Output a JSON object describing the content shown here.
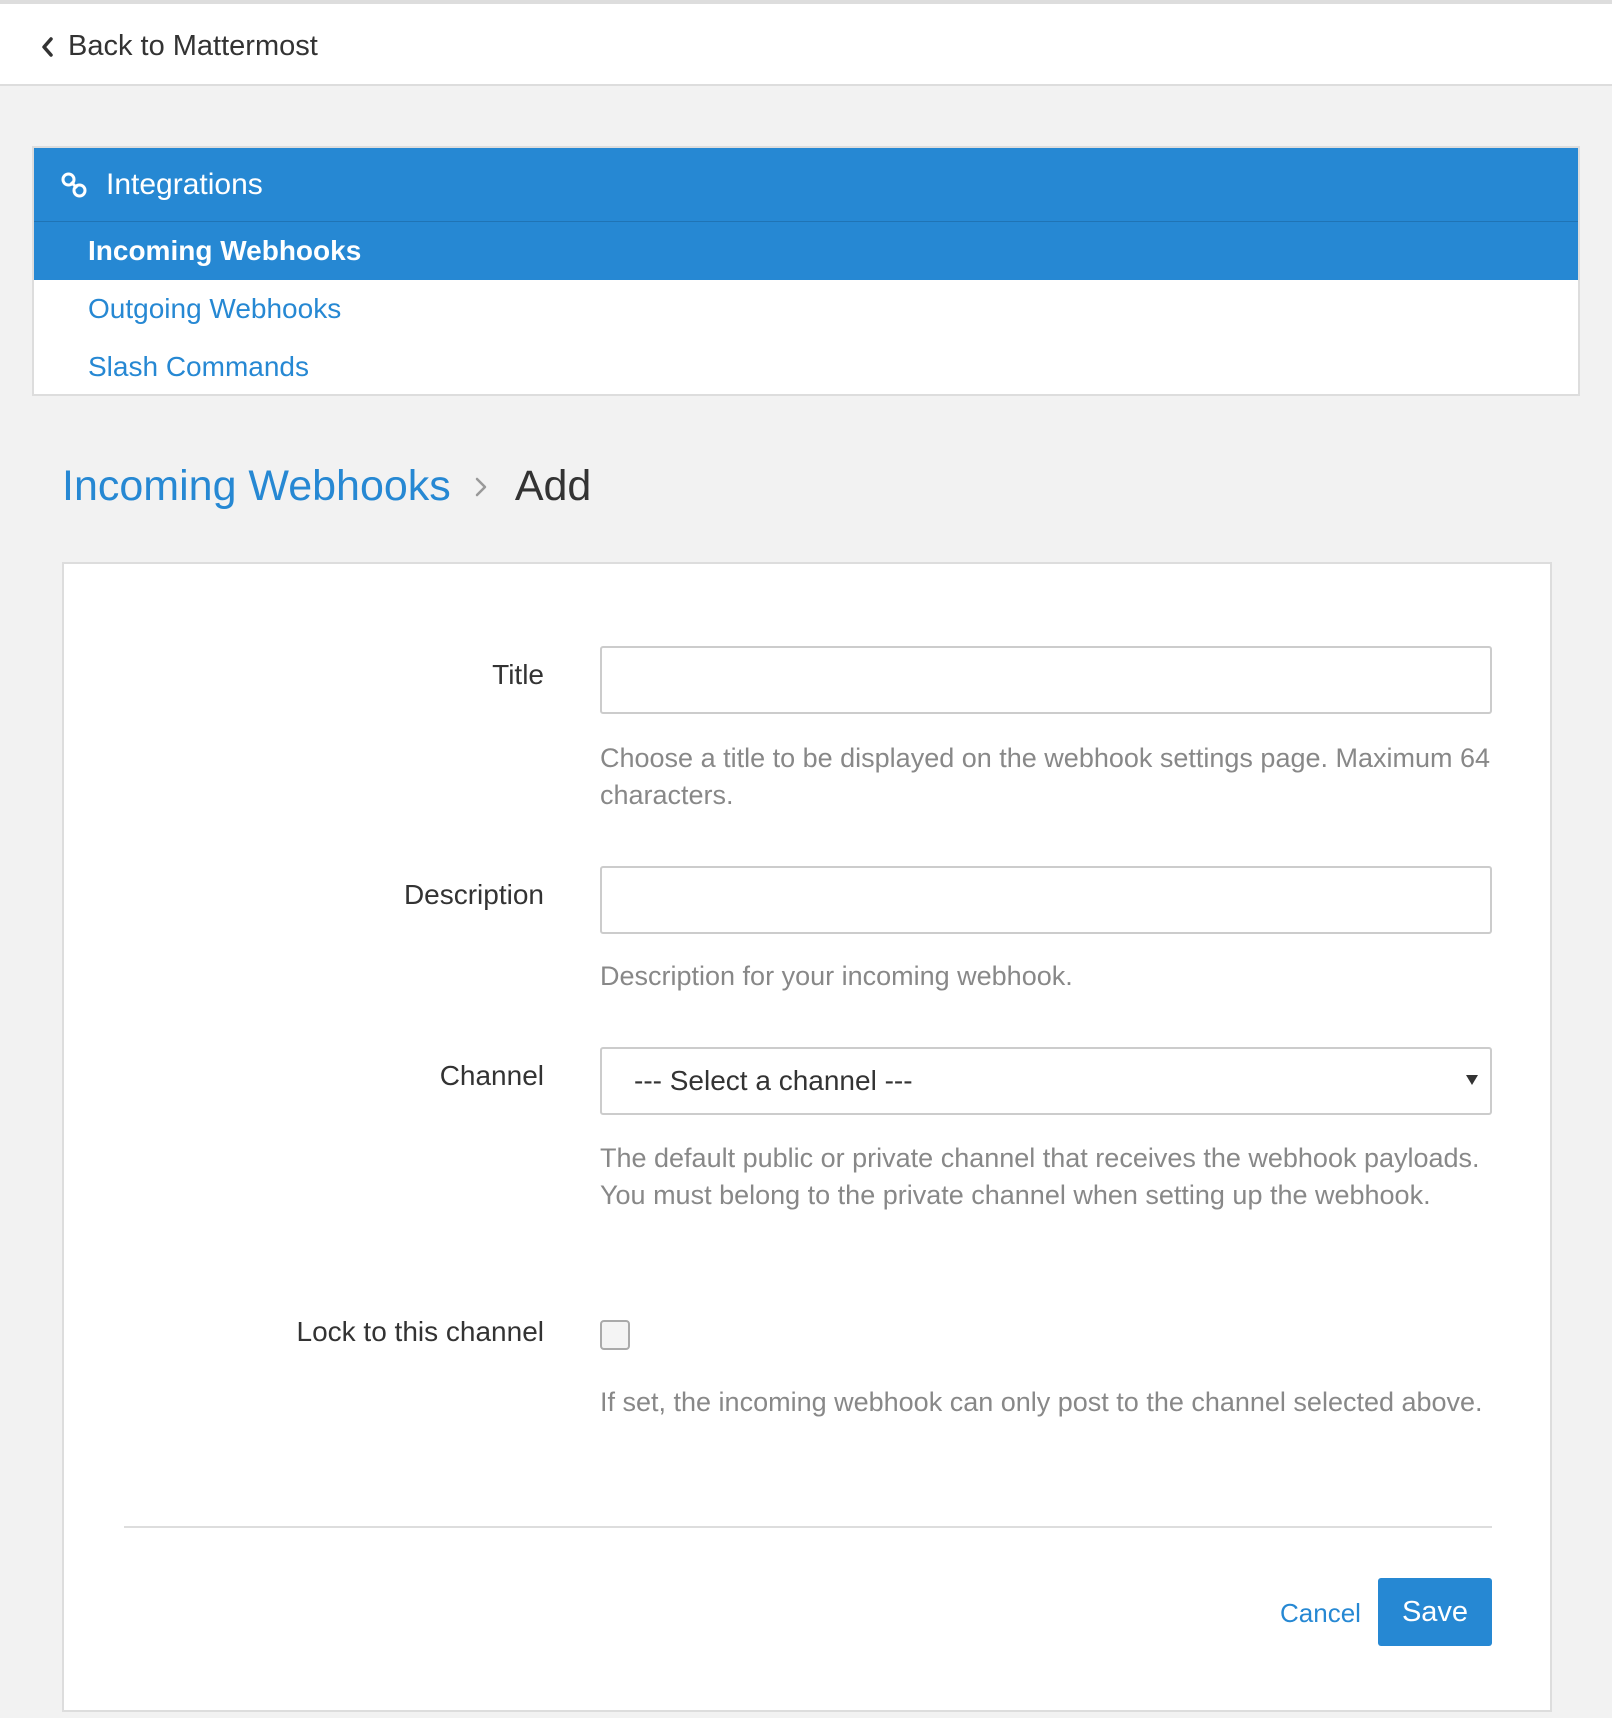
{
  "back_link": {
    "label": "Back to Mattermost"
  },
  "menu": {
    "header": "Integrations",
    "items": [
      {
        "label": "Incoming Webhooks",
        "active": true
      },
      {
        "label": "Outgoing Webhooks",
        "active": false
      },
      {
        "label": "Slash Commands",
        "active": false
      }
    ]
  },
  "breadcrumb": {
    "parent": "Incoming Webhooks",
    "current": "Add"
  },
  "form": {
    "title": {
      "label": "Title",
      "value": "",
      "help": "Choose a title to be displayed on the webhook settings page. Maximum 64 characters."
    },
    "description": {
      "label": "Description",
      "value": "",
      "help": "Description for your incoming webhook."
    },
    "channel": {
      "label": "Channel",
      "selected": "--- Select a channel ---",
      "help": "The default public or private channel that receives the webhook payloads. You must belong to the private channel when setting up the webhook."
    },
    "lock": {
      "label": "Lock to this channel",
      "checked": false,
      "help": "If set, the incoming webhook can only post to the channel selected above."
    }
  },
  "actions": {
    "cancel": "Cancel",
    "save": "Save"
  },
  "colors": {
    "accent": "#2688d3",
    "background": "#f2f2f2",
    "help_text": "#888888"
  },
  "icons": {
    "back": "chevron-left-icon",
    "integrations": "link-icon",
    "separator": "chevron-right-icon",
    "select": "caret-down-icon"
  }
}
